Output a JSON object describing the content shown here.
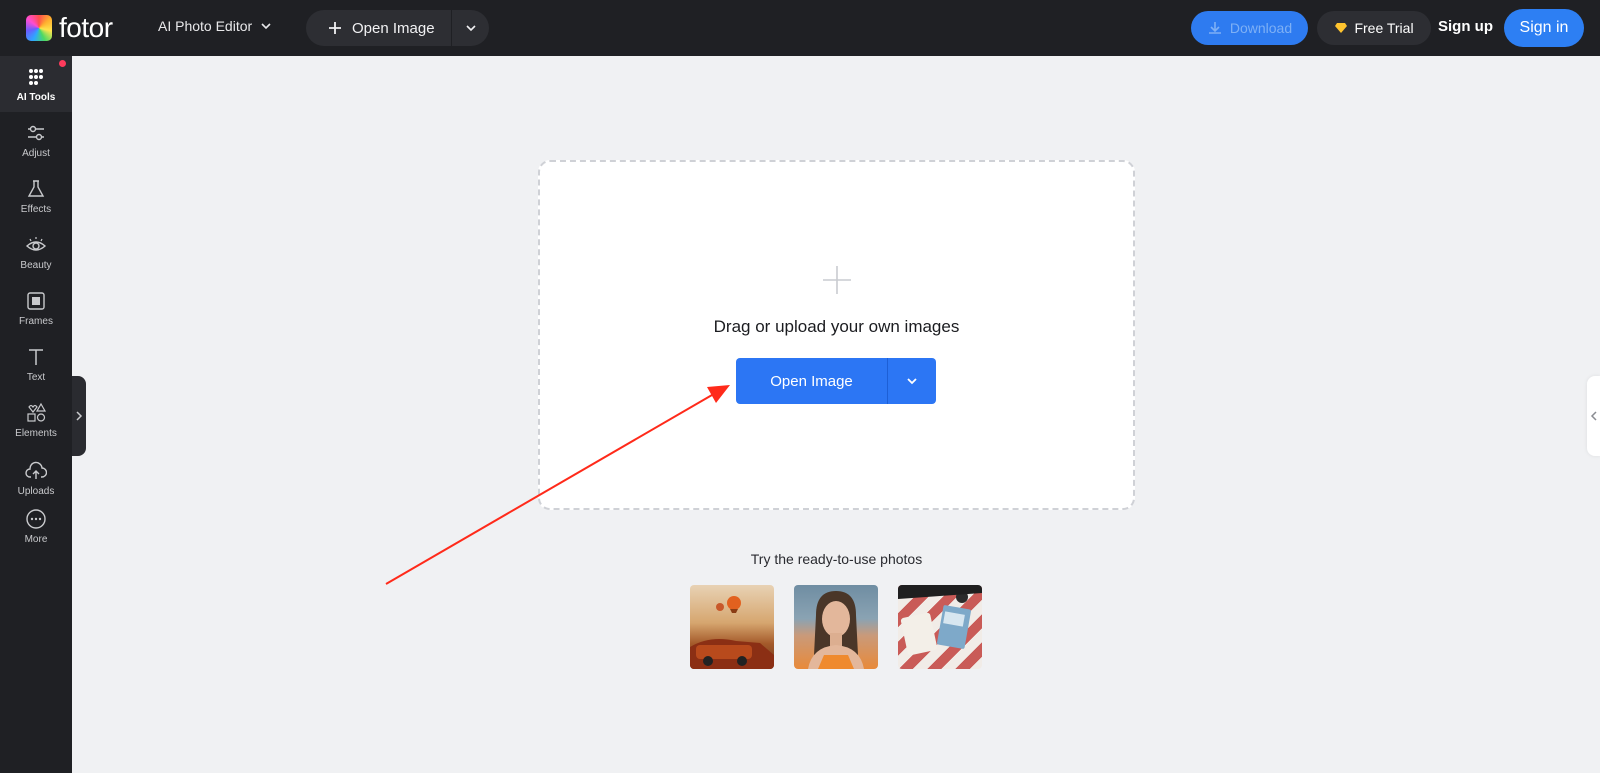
{
  "brand": {
    "name": "fotor"
  },
  "header": {
    "app_select": "AI Photo Editor",
    "open_image": "Open Image",
    "download": "Download",
    "free_trial": "Free Trial",
    "sign_up": "Sign up",
    "sign_in": "Sign in"
  },
  "sidebar": {
    "items": [
      {
        "label": "AI Tools",
        "icon": "grid-dots-icon"
      },
      {
        "label": "Adjust",
        "icon": "sliders-icon"
      },
      {
        "label": "Effects",
        "icon": "flask-icon"
      },
      {
        "label": "Beauty",
        "icon": "eye-icon"
      },
      {
        "label": "Frames",
        "icon": "frame-icon"
      },
      {
        "label": "Text",
        "icon": "text-icon"
      },
      {
        "label": "Elements",
        "icon": "shapes-icon"
      },
      {
        "label": "Uploads",
        "icon": "cloud-upload-icon"
      },
      {
        "label": "More",
        "icon": "more-icon"
      }
    ]
  },
  "upload": {
    "prompt": "Drag or upload your own images",
    "button": "Open Image"
  },
  "samples": {
    "title": "Try the ready-to-use photos",
    "photos": [
      "balloons-car",
      "portrait-woman",
      "picnic-table"
    ]
  },
  "colors": {
    "accent": "#2c76f4",
    "topbar": "#1f2024",
    "canvas": "#f0f1f3",
    "annotation_arrow": "#ff2a1a"
  }
}
